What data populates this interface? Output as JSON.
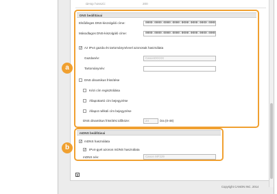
{
  "top": {
    "faded_label": "ΩHop hosszú:",
    "faded_value": "200"
  },
  "dns": {
    "header": "DNS beállításai",
    "primary_label": "Elsődleges DNS-kiszolgáló címe:",
    "primary_value": "0000:0000:0000:0000:0000:0000:0000:0000",
    "secondary_label": "Másodlagos DNS-kiszolgáló címe:",
    "secondary_value": "0000:0000:0000:0000:0000:0000:0000:0000",
    "same_host_label": "Az IPv4 gazda és tartománynévvel azonosak használata",
    "host_label": "Gazdanév:",
    "host_placeholder": "Canon0XXXX",
    "domain_label": "Tartománynév:",
    "dynamic_update_label": "DNS dinamikus frissítése",
    "manual_reg_label": "Kézi cím regisztrálása",
    "stateful_label": "Állapottartó cím bejegyzése",
    "stateless_label": "Állapot nélküli cím bejegyzése",
    "interval_label": "DNS dinamikus frissítési időköze:",
    "interval_value": "24",
    "interval_unit": "óra (0-48)"
  },
  "mdns": {
    "header": "mDNS beállításai",
    "use_label": "mDNS használata",
    "same_ipv4_label": "IPv4-gyel azonos mDNS használata",
    "name_label": "mDNS név:",
    "name_value": "Canon MF229"
  },
  "badges": {
    "a": "a",
    "b": "b"
  },
  "footer": {
    "copyright": "Copyright CANON INC. 2014"
  },
  "colors": {
    "highlight": "#f0a030"
  }
}
